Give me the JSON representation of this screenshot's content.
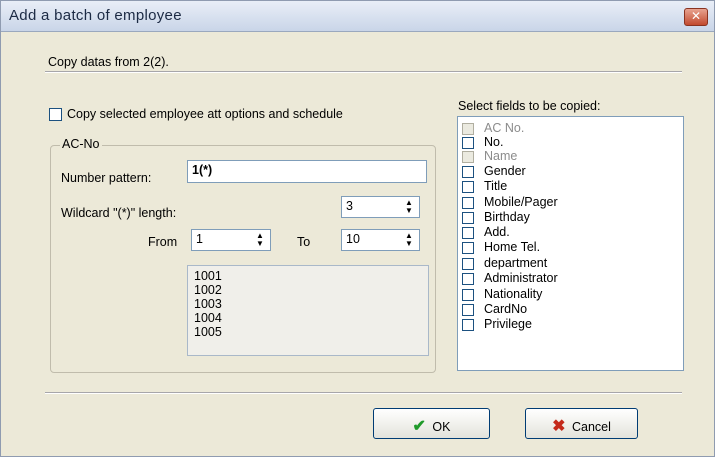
{
  "window": {
    "title": "Add a batch of employee",
    "close_symbol": "✕"
  },
  "header": {
    "copy_text": "Copy datas from 2(2)."
  },
  "copy_options": {
    "label": "Copy selected employee att options and schedule",
    "checked": false
  },
  "acno_group": {
    "legend": "AC-No",
    "number_pattern_label": "Number pattern:",
    "number_pattern_value": "1(*)",
    "wildcard_label": "Wildcard \"(*)\" length:",
    "wildcard_value": "3",
    "from_label": "From",
    "from_value": "1",
    "to_label": "To",
    "to_value": "10",
    "preview": [
      "1001",
      "1002",
      "1003",
      "1004",
      "1005"
    ]
  },
  "fields": {
    "title": "Select fields to be copied:",
    "items": [
      {
        "label": "AC No.",
        "disabled": true
      },
      {
        "label": "No.",
        "disabled": false
      },
      {
        "label": "Name",
        "disabled": true
      },
      {
        "label": "Gender",
        "disabled": false
      },
      {
        "label": "Title",
        "disabled": false
      },
      {
        "label": "Mobile/Pager",
        "disabled": false
      },
      {
        "label": "Birthday",
        "disabled": false
      },
      {
        "label": "Add.",
        "disabled": false
      },
      {
        "label": "Home Tel.",
        "disabled": false
      },
      {
        "label": "department",
        "disabled": false
      },
      {
        "label": "Administrator",
        "disabled": false
      },
      {
        "label": "Nationality",
        "disabled": false
      },
      {
        "label": "CardNo",
        "disabled": false
      },
      {
        "label": "Privilege",
        "disabled": false
      }
    ]
  },
  "buttons": {
    "ok_label": "OK",
    "cancel_label": "Cancel",
    "ok_icon": "✔",
    "cancel_icon": "✖"
  }
}
